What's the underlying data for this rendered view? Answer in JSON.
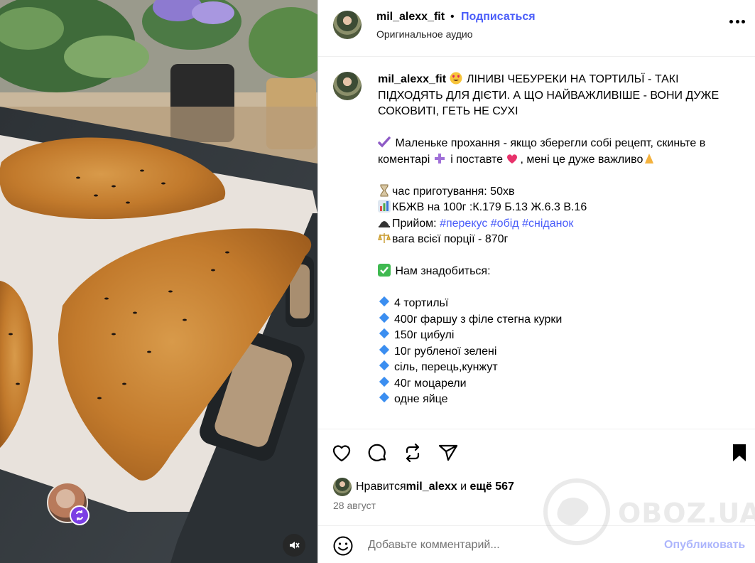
{
  "post": {
    "username": "mil_alexx_fit",
    "separator": "•",
    "follow_label": "Подписаться",
    "audio_label": "Оригинальное аудио"
  },
  "caption": {
    "username": "mil_alexx_fit",
    "title_text": " ЛІНИВІ ЧЕБУРЕКИ НА ТОРТИЛЬЇ - ТАКІ ПІДХОДЯТЬ ДЛЯ ДІЄТИ. А ЩО НАЙВАЖЛИВІШЕ - ВОНИ ДУЖЕ СОКОВИТІ, ГЕТЬ НЕ СУХІ",
    "request_part1": " Маленьке прохання - якщо зберегли собі рецепт, скиньте в коментарі ",
    "request_part2": " і поставте ",
    "request_part3": ", мені це дуже важливо",
    "time_line": "час приготування: 50хв",
    "kbju_line": "КБЖВ на 100г :К.179 Б.13 Ж.6.3 В.16",
    "meal_prefix": "Прийом: ",
    "meal_tags": [
      "#перекус",
      "#обід",
      "#сніданок"
    ],
    "weight_line": "вага всієї порції - 870г",
    "need_line": " Нам знадобиться:",
    "ingredients": [
      "4 тортильї",
      "400г фаршу з філе стегна курки",
      "150г цибулі",
      "10г рубленої зелені",
      "сіль, перець,кунжут",
      "40г моцарели",
      "одне яйце"
    ]
  },
  "likes": {
    "prefix": "Нравится ",
    "user": "mil_alexx",
    "middle": " и ",
    "rest": "ещё 567"
  },
  "date": "28 август",
  "comment": {
    "placeholder": "Добавьте комментарий...",
    "publish_label": "Опубликовать"
  },
  "watermark": "OBOZ.UA",
  "icons": {
    "like": "heart-icon",
    "comment": "comment-icon",
    "repost": "repost-icon",
    "share": "share-icon",
    "save": "bookmark-icon",
    "emoji": "emoji-icon",
    "mute": "mute-icon",
    "more": "more-options-icon"
  },
  "colors": {
    "link_blue": "#4a5df9",
    "secondary_text": "#737373",
    "divider": "#efefef"
  }
}
